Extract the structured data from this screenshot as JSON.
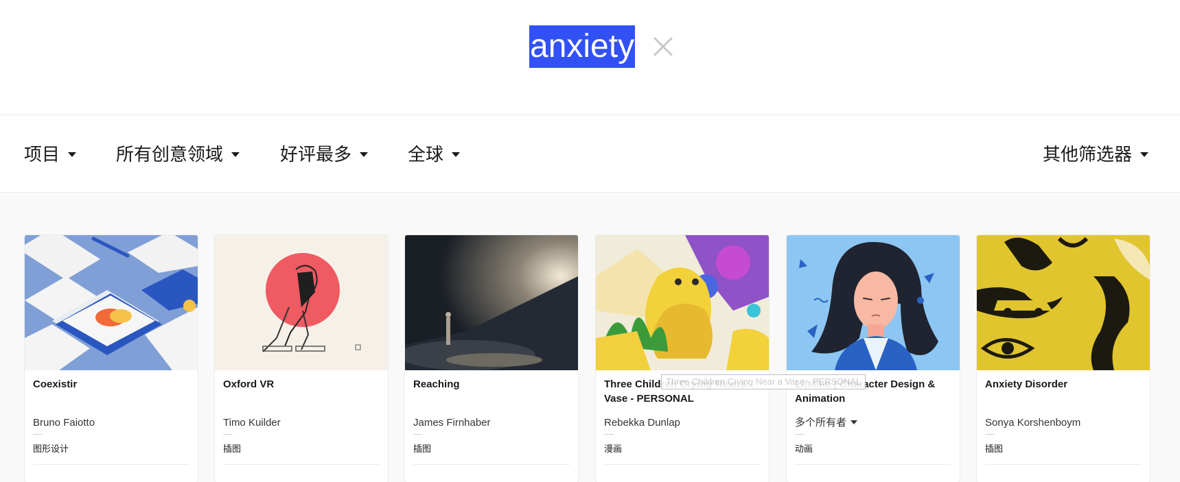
{
  "search": {
    "query": "anxiety",
    "clear_icon": "close-icon",
    "highlight_color": "#3151f5"
  },
  "filters": {
    "type": "项目",
    "fields": "所有创意领域",
    "sort": "好评最多",
    "location": "全球",
    "more": "其他筛选器"
  },
  "projects": [
    {
      "title": "Coexistir",
      "owner": "Bruno Faiotto",
      "field": "图形设计"
    },
    {
      "title": "Oxford VR",
      "owner": "Timo Kuilder",
      "field": "插图"
    },
    {
      "title": "Reaching",
      "owner": "James Firnhaber",
      "field": "插图"
    },
    {
      "title": "Three Children Crying Near a Vase - PERSONAL",
      "owner": "Rebekka Dunlap",
      "field": "漫画"
    },
    {
      "title": "Lifeline | Character Design & Animation",
      "owner": "多个所有者",
      "field": "动画"
    },
    {
      "title": "Anxiety Disorder",
      "owner": "Sonya Korshenboym",
      "field": "插图"
    }
  ],
  "tooltip": "Three Children Crying Near a Vase - PERSONAL"
}
